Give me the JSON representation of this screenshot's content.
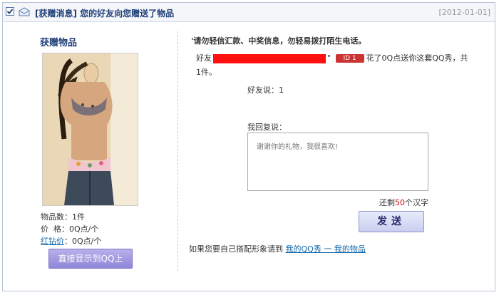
{
  "header": {
    "category": "[获赠消息]",
    "title": "您的好友向您赠送了物品",
    "date": "[2012-01-01]"
  },
  "gift": {
    "heading": "获赠物品",
    "count_label": "物品数：",
    "count_value": "1件",
    "price_label": "价  格：",
    "price_value": "0Q点/个",
    "diamond_label": "红钻价",
    "diamond_value": "：0Q点/个",
    "show_button": "直接显示到QQ上"
  },
  "message": {
    "warning": "'请勿轻信汇款、中奖信息，勿轻易拨打陌生电话。",
    "friend_prefix": "好友",
    "badge": "ID 1",
    "spend_text": "花了0Q点送你这套QQ秀，共",
    "count_text": "1件。",
    "friend_says": "好友说：1",
    "reply_label": "我回复说：",
    "reply_placeholder": "谢谢你的礼物，我很喜欢!",
    "remain_prefix": "还剩",
    "remain_count": "50",
    "remain_suffix": "个汉字",
    "send_button": "发送",
    "bottom_text": "如果您要自己搭配形象请到",
    "link_show": "我的QQ秀",
    "link_sep": " 一 ",
    "link_items": "我的物品"
  },
  "colors": {
    "accent": "#1f3f78",
    "redaction": "#ff1010",
    "remaining_count": "#cc0000"
  }
}
